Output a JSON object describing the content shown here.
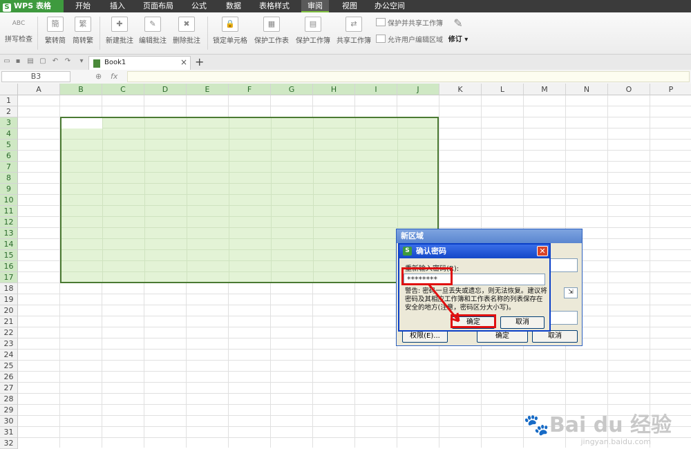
{
  "app": {
    "logo_text": "WPS 表格",
    "logo_letter": "S"
  },
  "menu": {
    "tabs": [
      {
        "label": "开始"
      },
      {
        "label": "插入"
      },
      {
        "label": "页面布局"
      },
      {
        "label": "公式"
      },
      {
        "label": "数据"
      },
      {
        "label": "表格样式"
      },
      {
        "label": "审阅",
        "active": true
      },
      {
        "label": "视图"
      },
      {
        "label": "办公空间"
      }
    ]
  },
  "ribbon": {
    "spell_check": "拼写检查",
    "spell_icon": "ABC",
    "trad_to_simp": "繁转简",
    "simp_to_trad": "简转繁",
    "new_comment": "新建批注",
    "edit_comment": "编辑批注",
    "delete_comment": "删除批注",
    "lock_cell": "锁定单元格",
    "protect_sheet": "保护工作表",
    "protect_book": "保护工作簿",
    "share_book": "共享工作簿",
    "protect_share": "保护并共享工作簿",
    "allow_edit": "允许用户编辑区域",
    "revision": "修订"
  },
  "tabbar": {
    "book_name": "Book1"
  },
  "formula_bar": {
    "cell_ref": "B3",
    "fx_label": "fx"
  },
  "grid": {
    "columns": [
      "A",
      "B",
      "C",
      "D",
      "E",
      "F",
      "G",
      "H",
      "I",
      "J",
      "K",
      "L",
      "M",
      "N",
      "O",
      "P"
    ],
    "rows": [
      "1",
      "2",
      "3",
      "4",
      "5",
      "6",
      "7",
      "8",
      "9",
      "10",
      "11",
      "12",
      "13",
      "14",
      "15",
      "16",
      "17",
      "18",
      "19",
      "20",
      "21",
      "22",
      "23",
      "24",
      "25",
      "26",
      "27",
      "28",
      "29",
      "30",
      "31",
      "32"
    ]
  },
  "dialog_region": {
    "title": "新区域",
    "permission_button": "权限(E)...",
    "ok_button": "确定",
    "cancel_button": "取消"
  },
  "dialog_confirm": {
    "title": "确认密码",
    "prompt": "重新输入密码(R):",
    "password_value": "********",
    "warning": "警告: 密码一旦丢失或遗忘，则无法恢复。建议将密码及其相应工作簿和工作表名称的列表保存在安全的地方(注意，密码区分大小写)。",
    "ok_button": "确定",
    "cancel_button": "取消",
    "close_glyph": "✕"
  },
  "watermark": {
    "brand": "Bai du 经验",
    "url": "jingyan.baidu.com"
  },
  "colors": {
    "accent_green": "#3e9a3e",
    "selection_fill": "#e3f3d6",
    "highlight_red": "#e01010",
    "dialog_title_blue": "#1448c8"
  }
}
